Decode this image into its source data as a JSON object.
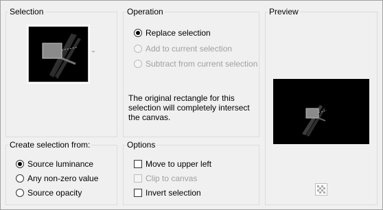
{
  "selection": {
    "title": "Selection"
  },
  "operation": {
    "title": "Operation",
    "options": [
      {
        "label": "Replace selection",
        "checked": true,
        "enabled": true
      },
      {
        "label": "Add to current selection",
        "checked": false,
        "enabled": false
      },
      {
        "label": "Subtract from current selection",
        "checked": false,
        "enabled": false
      }
    ],
    "info": "The original rectangle for this selection will completely intersect the canvas."
  },
  "preview": {
    "title": "Preview",
    "toggle_icon": "checkerboard-icon"
  },
  "create_from": {
    "title": "Create selection from:",
    "options": [
      {
        "label": "Source luminance",
        "checked": true
      },
      {
        "label": "Any non-zero value",
        "checked": false
      },
      {
        "label": "Source opacity",
        "checked": false
      }
    ]
  },
  "options": {
    "title": "Options",
    "items": [
      {
        "label": "Move to upper left",
        "checked": false,
        "enabled": true
      },
      {
        "label": "Clip to canvas",
        "checked": false,
        "enabled": false
      },
      {
        "label": "Invert selection",
        "checked": false,
        "enabled": true
      }
    ]
  }
}
